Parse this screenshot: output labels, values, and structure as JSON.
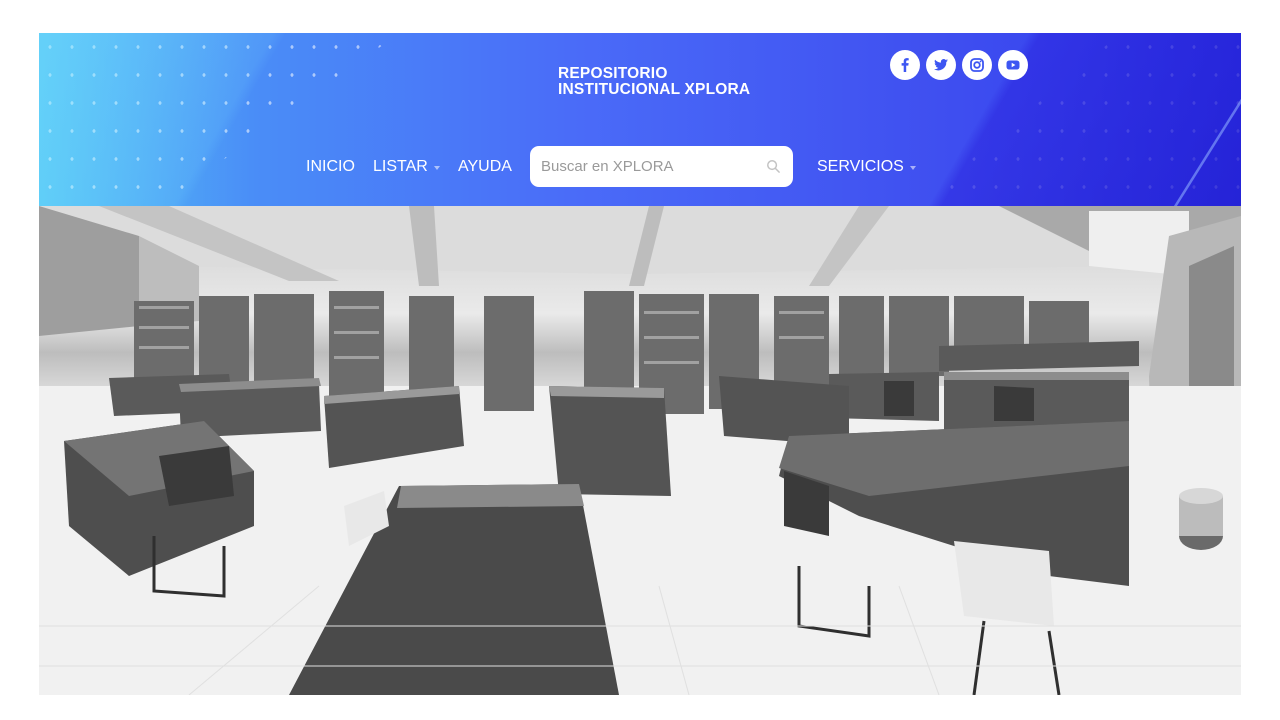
{
  "brand": {
    "line1": "REPOSITORIO",
    "line2": "INSTITUCIONAL XPLORA"
  },
  "social": [
    {
      "name": "facebook",
      "icon": "facebook-icon"
    },
    {
      "name": "twitter",
      "icon": "twitter-icon"
    },
    {
      "name": "instagram",
      "icon": "instagram-icon"
    },
    {
      "name": "youtube",
      "icon": "youtube-icon"
    }
  ],
  "nav": {
    "inicio": "INICIO",
    "listar": "LISTAR",
    "ayuda": "AYUDA",
    "servicios": "SERVICIOS"
  },
  "search": {
    "placeholder": "Buscar en XPLORA",
    "icon": "search-icon"
  },
  "hero": {
    "description_icon": "library-reading-room-photo"
  },
  "colors": {
    "header_start": "#55c8f5",
    "header_end": "#2f3aed",
    "social_icon_fg": "#3d56f2"
  }
}
